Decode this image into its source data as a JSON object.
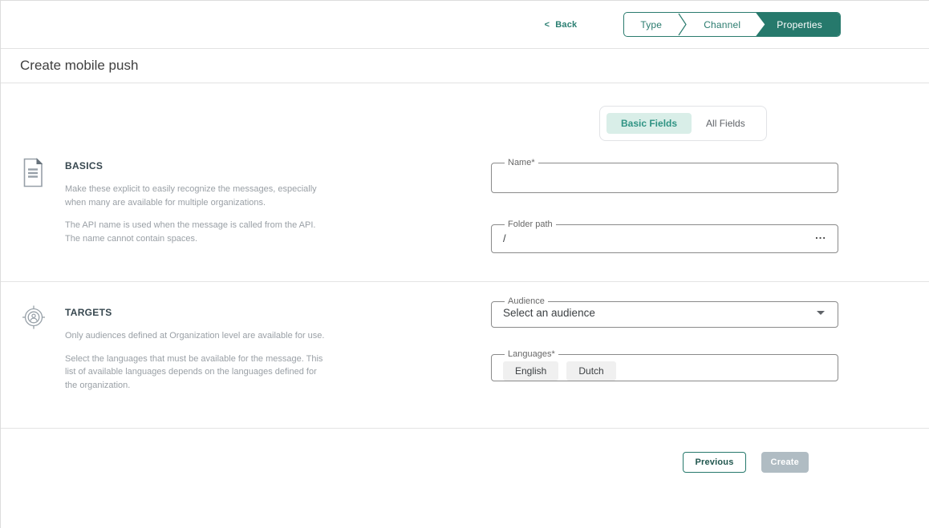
{
  "header": {
    "back_chevron": "<",
    "back_label": "Back",
    "steps": [
      {
        "label": "Type"
      },
      {
        "label": "Channel"
      },
      {
        "label": "Properties"
      }
    ]
  },
  "page": {
    "title": "Create mobile push"
  },
  "tabs": {
    "basic_label": "Basic Fields",
    "all_label": "All Fields"
  },
  "sections": {
    "basics": {
      "heading": "BASICS",
      "icon": "document-icon",
      "paragraphs": [
        "Make these explicit to easily recognize the messages, especially when many are available for multiple organizations.",
        "The API name is used when the message is called from the API. The name cannot contain spaces."
      ],
      "fields": {
        "name": {
          "label": "Name*",
          "value": ""
        },
        "folder_path": {
          "label": "Folder path",
          "value": "/",
          "action": "..."
        }
      }
    },
    "targets": {
      "heading": "TARGETS",
      "icon": "audience-target-icon",
      "paragraphs": [
        "Only audiences defined at Organization level are available for use.",
        "Select the languages that must be available for the message. This list of available languages depends on the languages defined for the organization."
      ],
      "fields": {
        "audience": {
          "label": "Audience",
          "value": "Select an audience"
        },
        "languages": {
          "label": "Languages*",
          "chips": [
            "English",
            "Dutch"
          ]
        }
      }
    }
  },
  "footer": {
    "previous_label": "Previous",
    "create_label": "Create"
  },
  "colors": {
    "primary": "#26796C",
    "primary_light": "#D9EEE8",
    "disabled_button": "#B0BCC3"
  }
}
